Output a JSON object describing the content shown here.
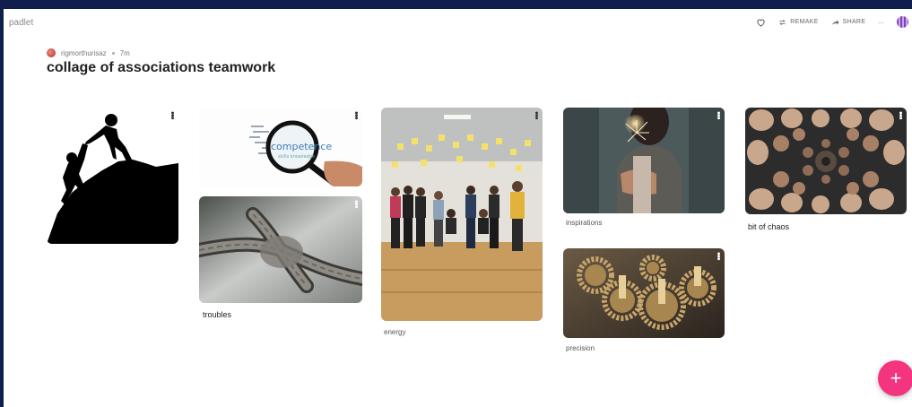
{
  "app": {
    "brand": "padlet"
  },
  "toolbar": {
    "remake_label": "REMAKE",
    "share_label": "SHARE",
    "more_label": "..."
  },
  "post_meta": {
    "author": "rigmorthurisaz",
    "time": "7m"
  },
  "board": {
    "title": "collage of associations teamwork"
  },
  "cards": {
    "climb": {
      "caption": ""
    },
    "competence": {
      "caption": ""
    },
    "troubles": {
      "caption": "troubles"
    },
    "energy": {
      "caption": "energy"
    },
    "inspirations": {
      "caption": "inspirations"
    },
    "precision": {
      "caption": "precision"
    },
    "chaos": {
      "caption": "bit of chaos"
    }
  },
  "colors": {
    "background_frame": "#0f1e4a",
    "fab": "#f5347f",
    "title": "#222222"
  },
  "icons": {
    "like": "heart-icon",
    "remake": "remake-icon",
    "share": "share-icon",
    "more": "more-dots-icon",
    "add": "plus-icon"
  },
  "fab": {
    "label": "+"
  }
}
